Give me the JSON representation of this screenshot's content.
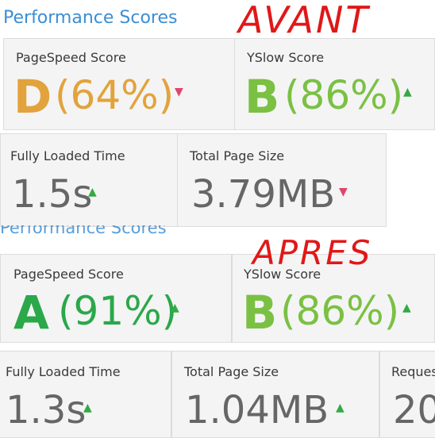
{
  "colors": {
    "title_blue": "#3a8ed6",
    "grade_d": "#e2a33c",
    "grade_b": "#7ac143",
    "grade_a": "#2aa84a",
    "metric_gray": "#666666",
    "arrow_up": "#33aa44",
    "arrow_down": "#e0456b",
    "handwriting_red": "#e01818"
  },
  "before": {
    "section_title": "Performance Scores",
    "annotation": "AVANT",
    "pagespeed": {
      "label": "PageSpeed Score",
      "grade": "D",
      "percent": "(64%)",
      "trend": "down",
      "trend_icon": "chevron-down-icon"
    },
    "yslow": {
      "label": "YSlow Score",
      "grade": "B",
      "percent": "(86%)",
      "trend": "up",
      "trend_icon": "chevron-up-icon"
    },
    "load_time": {
      "label": "Fully Loaded Time",
      "value": "1.5s",
      "trend": "up",
      "trend_icon": "chevron-up-icon"
    },
    "page_size": {
      "label": "Total Page Size",
      "value": "3.79MB",
      "trend": "down",
      "trend_icon": "chevron-down-icon"
    }
  },
  "after": {
    "section_title": "Performance Scores",
    "annotation": "APRES",
    "pagespeed": {
      "label": "PageSpeed Score",
      "grade": "A",
      "percent": "(91%)",
      "trend": "up",
      "trend_icon": "chevron-up-icon"
    },
    "yslow": {
      "label": "YSlow Score",
      "grade": "B",
      "percent": "(86%)",
      "trend": "up",
      "trend_icon": "chevron-up-icon"
    },
    "load_time": {
      "label": "Fully Loaded Time",
      "value": "1.3s",
      "trend": "up",
      "trend_icon": "chevron-up-icon"
    },
    "page_size": {
      "label": "Total Page Size",
      "value": "1.04MB",
      "trend": "up",
      "trend_icon": "chevron-up-icon"
    },
    "requests": {
      "label": "Reques",
      "value": "20"
    }
  }
}
